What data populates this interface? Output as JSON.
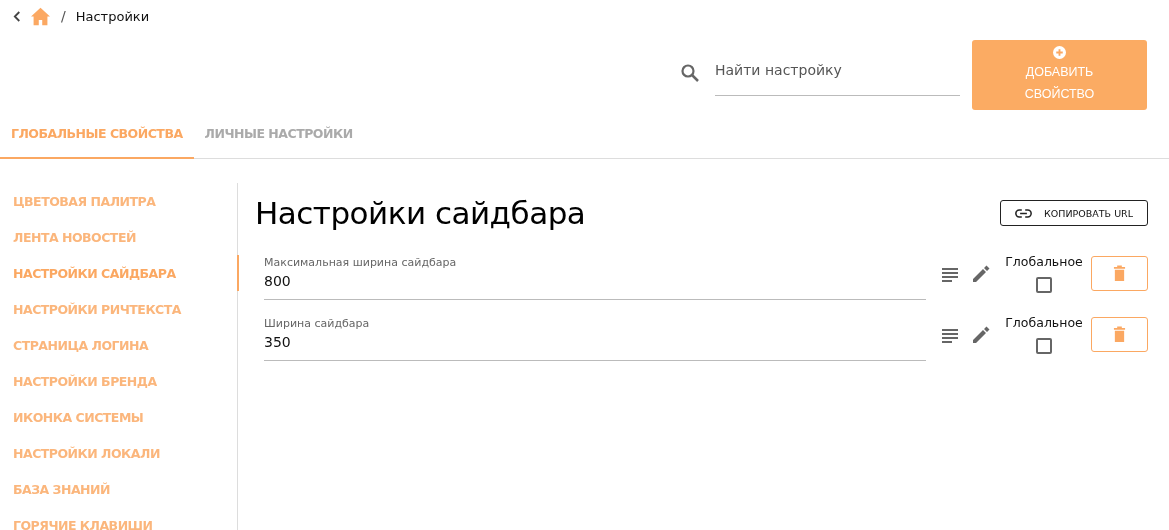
{
  "breadcrumb": {
    "separator": "/",
    "current": "Настройки"
  },
  "search": {
    "placeholder": "Найти настройку"
  },
  "add_button": {
    "label": "ДОБАВИТЬ СВОЙСТВО"
  },
  "tabs": [
    {
      "label": "ГЛОБАЛЬНЫЕ СВОЙСТВА",
      "selected": true
    },
    {
      "label": "ЛИЧНЫЕ НАСТРОЙКИ",
      "selected": false
    }
  ],
  "sidebar": {
    "items": [
      {
        "label": "ЦВЕТОВАЯ ПАЛИТРА",
        "selected": false
      },
      {
        "label": "ЛЕНТА НОВОСТЕЙ",
        "selected": false
      },
      {
        "label": "НАСТРОЙКИ САЙДБАРА",
        "selected": true
      },
      {
        "label": "НАСТРОЙКИ РИЧТЕКСТА",
        "selected": false
      },
      {
        "label": "СТРАНИЦА ЛОГИНА",
        "selected": false
      },
      {
        "label": "НАСТРОЙКИ БРЕНДА",
        "selected": false
      },
      {
        "label": "ИКОНКА СИСТЕМЫ",
        "selected": false
      },
      {
        "label": "НАСТРОЙКИ ЛОКАЛИ",
        "selected": false
      },
      {
        "label": "БАЗА ЗНАНИЙ",
        "selected": false
      },
      {
        "label": "ГОРЯЧИЕ КЛАВИШИ",
        "selected": false
      }
    ]
  },
  "section": {
    "title": "Настройки сайдбара",
    "copy_button": "КОПИРОВАТЬ URL"
  },
  "properties": [
    {
      "label": "Максимальная ширина сайдбара",
      "value": "800",
      "global_label": "Глобальное",
      "global": false
    },
    {
      "label": "Ширина сайдбара",
      "value": "350",
      "global_label": "Глобальное",
      "global": false
    }
  ]
}
